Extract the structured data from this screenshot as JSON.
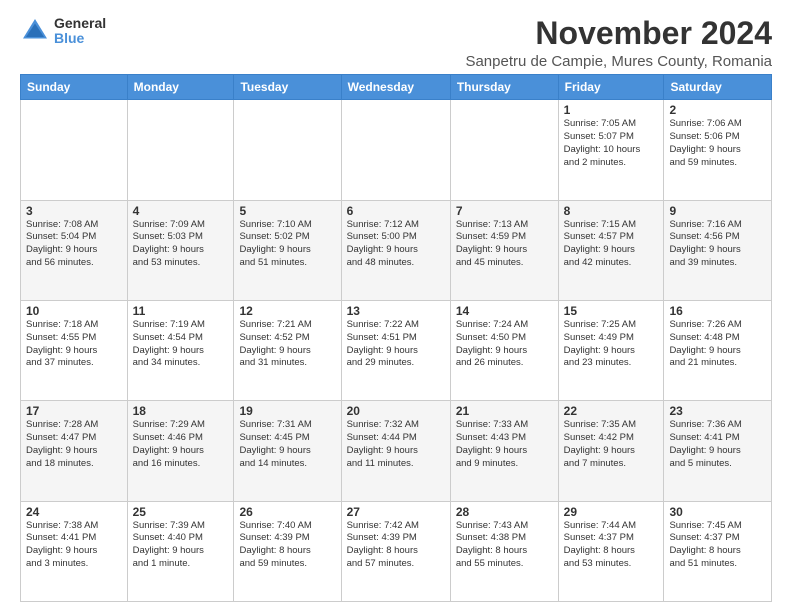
{
  "logo": {
    "general": "General",
    "blue": "Blue"
  },
  "title": "November 2024",
  "location": "Sanpetru de Campie, Mures County, Romania",
  "headers": [
    "Sunday",
    "Monday",
    "Tuesday",
    "Wednesday",
    "Thursday",
    "Friday",
    "Saturday"
  ],
  "weeks": [
    [
      {
        "day": "",
        "info": ""
      },
      {
        "day": "",
        "info": ""
      },
      {
        "day": "",
        "info": ""
      },
      {
        "day": "",
        "info": ""
      },
      {
        "day": "",
        "info": ""
      },
      {
        "day": "1",
        "info": "Sunrise: 7:05 AM\nSunset: 5:07 PM\nDaylight: 10 hours\nand 2 minutes."
      },
      {
        "day": "2",
        "info": "Sunrise: 7:06 AM\nSunset: 5:06 PM\nDaylight: 9 hours\nand 59 minutes."
      }
    ],
    [
      {
        "day": "3",
        "info": "Sunrise: 7:08 AM\nSunset: 5:04 PM\nDaylight: 9 hours\nand 56 minutes."
      },
      {
        "day": "4",
        "info": "Sunrise: 7:09 AM\nSunset: 5:03 PM\nDaylight: 9 hours\nand 53 minutes."
      },
      {
        "day": "5",
        "info": "Sunrise: 7:10 AM\nSunset: 5:02 PM\nDaylight: 9 hours\nand 51 minutes."
      },
      {
        "day": "6",
        "info": "Sunrise: 7:12 AM\nSunset: 5:00 PM\nDaylight: 9 hours\nand 48 minutes."
      },
      {
        "day": "7",
        "info": "Sunrise: 7:13 AM\nSunset: 4:59 PM\nDaylight: 9 hours\nand 45 minutes."
      },
      {
        "day": "8",
        "info": "Sunrise: 7:15 AM\nSunset: 4:57 PM\nDaylight: 9 hours\nand 42 minutes."
      },
      {
        "day": "9",
        "info": "Sunrise: 7:16 AM\nSunset: 4:56 PM\nDaylight: 9 hours\nand 39 minutes."
      }
    ],
    [
      {
        "day": "10",
        "info": "Sunrise: 7:18 AM\nSunset: 4:55 PM\nDaylight: 9 hours\nand 37 minutes."
      },
      {
        "day": "11",
        "info": "Sunrise: 7:19 AM\nSunset: 4:54 PM\nDaylight: 9 hours\nand 34 minutes."
      },
      {
        "day": "12",
        "info": "Sunrise: 7:21 AM\nSunset: 4:52 PM\nDaylight: 9 hours\nand 31 minutes."
      },
      {
        "day": "13",
        "info": "Sunrise: 7:22 AM\nSunset: 4:51 PM\nDaylight: 9 hours\nand 29 minutes."
      },
      {
        "day": "14",
        "info": "Sunrise: 7:24 AM\nSunset: 4:50 PM\nDaylight: 9 hours\nand 26 minutes."
      },
      {
        "day": "15",
        "info": "Sunrise: 7:25 AM\nSunset: 4:49 PM\nDaylight: 9 hours\nand 23 minutes."
      },
      {
        "day": "16",
        "info": "Sunrise: 7:26 AM\nSunset: 4:48 PM\nDaylight: 9 hours\nand 21 minutes."
      }
    ],
    [
      {
        "day": "17",
        "info": "Sunrise: 7:28 AM\nSunset: 4:47 PM\nDaylight: 9 hours\nand 18 minutes."
      },
      {
        "day": "18",
        "info": "Sunrise: 7:29 AM\nSunset: 4:46 PM\nDaylight: 9 hours\nand 16 minutes."
      },
      {
        "day": "19",
        "info": "Sunrise: 7:31 AM\nSunset: 4:45 PM\nDaylight: 9 hours\nand 14 minutes."
      },
      {
        "day": "20",
        "info": "Sunrise: 7:32 AM\nSunset: 4:44 PM\nDaylight: 9 hours\nand 11 minutes."
      },
      {
        "day": "21",
        "info": "Sunrise: 7:33 AM\nSunset: 4:43 PM\nDaylight: 9 hours\nand 9 minutes."
      },
      {
        "day": "22",
        "info": "Sunrise: 7:35 AM\nSunset: 4:42 PM\nDaylight: 9 hours\nand 7 minutes."
      },
      {
        "day": "23",
        "info": "Sunrise: 7:36 AM\nSunset: 4:41 PM\nDaylight: 9 hours\nand 5 minutes."
      }
    ],
    [
      {
        "day": "24",
        "info": "Sunrise: 7:38 AM\nSunset: 4:41 PM\nDaylight: 9 hours\nand 3 minutes."
      },
      {
        "day": "25",
        "info": "Sunrise: 7:39 AM\nSunset: 4:40 PM\nDaylight: 9 hours\nand 1 minute."
      },
      {
        "day": "26",
        "info": "Sunrise: 7:40 AM\nSunset: 4:39 PM\nDaylight: 8 hours\nand 59 minutes."
      },
      {
        "day": "27",
        "info": "Sunrise: 7:42 AM\nSunset: 4:39 PM\nDaylight: 8 hours\nand 57 minutes."
      },
      {
        "day": "28",
        "info": "Sunrise: 7:43 AM\nSunset: 4:38 PM\nDaylight: 8 hours\nand 55 minutes."
      },
      {
        "day": "29",
        "info": "Sunrise: 7:44 AM\nSunset: 4:37 PM\nDaylight: 8 hours\nand 53 minutes."
      },
      {
        "day": "30",
        "info": "Sunrise: 7:45 AM\nSunset: 4:37 PM\nDaylight: 8 hours\nand 51 minutes."
      }
    ]
  ]
}
